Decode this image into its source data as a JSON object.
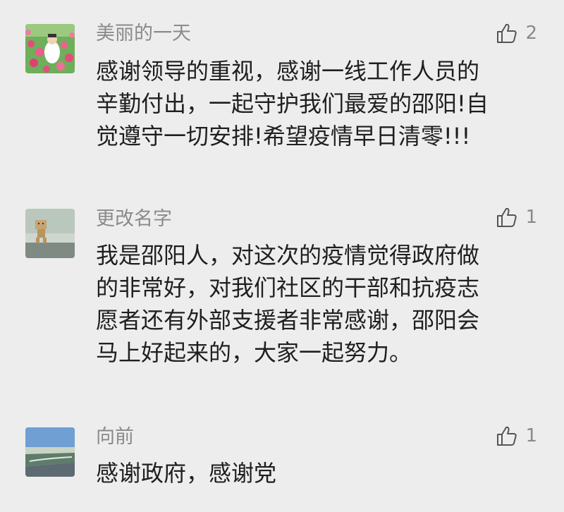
{
  "comments": [
    {
      "username": "美丽的一天",
      "likes": "2",
      "avatar": "pink-flower-field-avatar",
      "lines": [
        "感谢领导的重视，感谢一线工作人员的",
        "辛勤付出，一起守护我们最爱的邵阳!自",
        "觉遵守一切安排!希望疫情早日清零!!!"
      ]
    },
    {
      "username": "更改名字",
      "likes": "1",
      "avatar": "cardboard-robot-avatar",
      "lines": [
        "我是邵阳人，对这次的疫情觉得政府做",
        "的非常好，对我们社区的干部和抗疫志",
        "愿者还有外部支援者非常感谢，邵阳会",
        "马上好起来的，大家一起努力。"
      ]
    },
    {
      "username": "向前",
      "likes": "1",
      "avatar": "river-landscape-avatar",
      "lines": [
        "感谢政府，感谢党"
      ]
    }
  ],
  "colors": {
    "background": "#ededed",
    "username": "#8a8a8a",
    "text": "#1f1f1f"
  },
  "icons": {
    "like": "thumbs-up-icon"
  }
}
